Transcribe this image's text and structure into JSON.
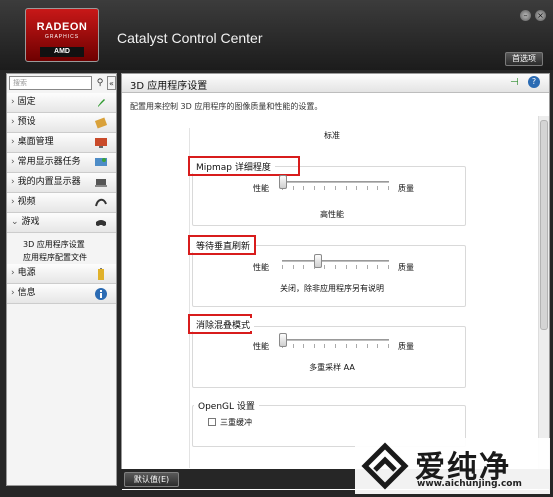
{
  "window": {
    "title": "Catalyst Control Center",
    "preferences_label": "首选项"
  },
  "logo": {
    "line1": "RADEON",
    "line2": "GRAPHICS",
    "line3": "AMD"
  },
  "sidebar": {
    "search_placeholder": "搜索",
    "items": [
      {
        "label": "固定",
        "icon": "pin-icon"
      },
      {
        "label": "预设",
        "icon": "preset-icon"
      },
      {
        "label": "桌面管理",
        "icon": "desktop-icon"
      },
      {
        "label": "常用显示器任务",
        "icon": "monitor-icon"
      },
      {
        "label": "我的内置显示器",
        "icon": "laptop-icon"
      },
      {
        "label": "视频",
        "icon": "video-icon"
      },
      {
        "label": "游戏",
        "icon": "gamepad-icon",
        "expanded": true
      },
      {
        "label": "电源",
        "icon": "battery-icon"
      },
      {
        "label": "信息",
        "icon": "info-icon"
      }
    ],
    "sub_items": [
      "3D 应用程序设置",
      "应用程序配置文件"
    ]
  },
  "main": {
    "title": "3D 应用程序设置",
    "description": "配置用来控制 3D 应用程序的图像质量和性能的设置。",
    "top_value": "标准",
    "sections": [
      {
        "title": "Mipmap 详细程度",
        "left_label": "性能",
        "right_label": "质量",
        "value": "高性能",
        "slider_fraction": 0.0
      },
      {
        "title": "等待垂直刷新",
        "left_label": "性能",
        "right_label": "质量",
        "value": "关闭，除非应用程序另有说明",
        "slider_fraction": 0.33
      },
      {
        "title": "消除混叠模式",
        "left_label": "性能",
        "right_label": "质量",
        "value": "多重采样 AA",
        "slider_fraction": 0.0
      }
    ],
    "opengl": {
      "title": "OpenGL 设置",
      "checkbox_label": "三重缓冲",
      "checked": false
    }
  },
  "footer": {
    "default_button": "默认值(E)"
  },
  "watermark": {
    "text": "爱纯净",
    "url": "www.aichunjing.com"
  },
  "colors": {
    "highlight_border": "#d81c1c",
    "header_dark": "#262626"
  }
}
